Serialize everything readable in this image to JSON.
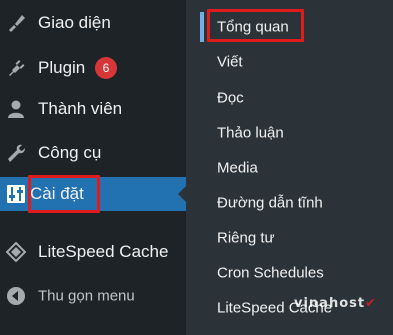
{
  "sidebar": {
    "items": [
      {
        "label": "Giao diện",
        "icon": "paintbrush-icon"
      },
      {
        "label": "Plugin",
        "icon": "plugin-icon",
        "badge": "6"
      },
      {
        "label": "Thành viên",
        "icon": "users-icon"
      },
      {
        "label": "Công cụ",
        "icon": "wrench-icon"
      },
      {
        "label": "Cài đặt",
        "icon": "settings-sliders-icon",
        "active": true
      },
      {
        "label": "LiteSpeed Cache",
        "icon": "litespeed-diamond-icon"
      },
      {
        "label": "Thu gọn menu",
        "icon": "collapse-arrow-icon"
      }
    ]
  },
  "submenu": {
    "items": [
      {
        "label": "Tổng quan",
        "current": true
      },
      {
        "label": "Viết"
      },
      {
        "label": "Đọc"
      },
      {
        "label": "Thảo luận"
      },
      {
        "label": "Media"
      },
      {
        "label": "Đường dẫn tĩnh"
      },
      {
        "label": "Riêng tư"
      },
      {
        "label": "Cron Schedules"
      },
      {
        "label": "LiteSpeed Cache"
      }
    ]
  },
  "colors": {
    "sidebar_bg": "#1d2327",
    "submenu_bg": "#2c3338",
    "active_bg": "#2271b1",
    "highlight_red": "#e01b1b",
    "badge_red": "#d63638"
  },
  "watermark": {
    "text": "vinahost",
    "mark": "✔"
  }
}
